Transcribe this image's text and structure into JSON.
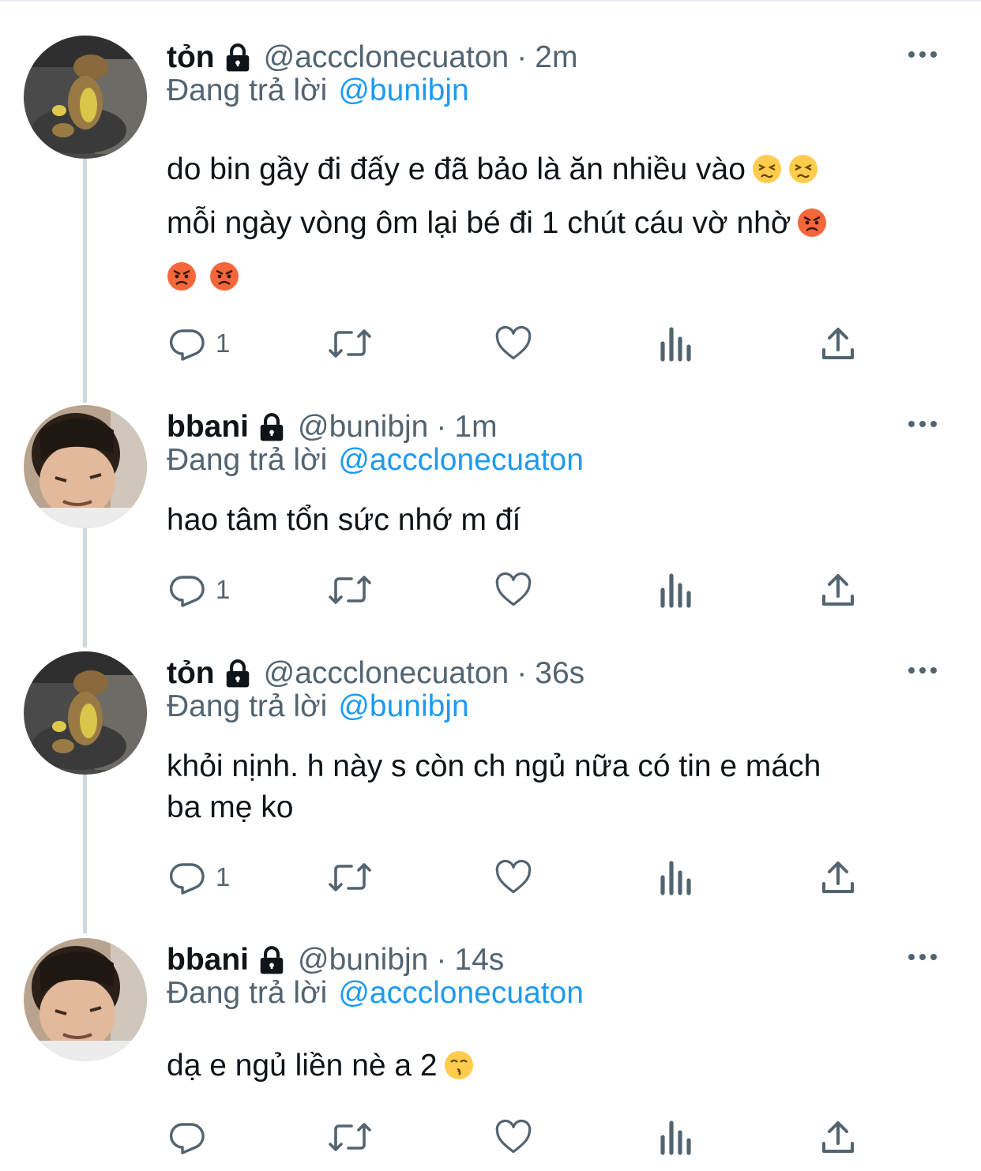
{
  "tweets": [
    {
      "name": "tỏn",
      "handle": "@accclonecuaton",
      "separator": "·",
      "time": "2m",
      "reply_label": "Đang trả lời",
      "reply_to": "@bunibjn",
      "text_lines": [
        "do bin gầy đi đấy e đã bảo là ăn nhiều vào",
        "mỗi ngày vòng ôm lại bé đi 1 chút cáu vờ nhờ"
      ],
      "reply_count": "1",
      "avatar": "dinosaur-plush-photo"
    },
    {
      "name": "bbani",
      "handle": "@bunibjn",
      "separator": "·",
      "time": "1m",
      "reply_label": "Đang trả lời",
      "reply_to": "@accclonecuaton",
      "text_lines": [
        "hao tâm tổn sức nhớ m đí"
      ],
      "reply_count": "1",
      "avatar": "person-face-photo"
    },
    {
      "name": "tỏn",
      "handle": "@accclonecuaton",
      "separator": "·",
      "time": "36s",
      "reply_label": "Đang trả lời",
      "reply_to": "@bunibjn",
      "text_lines": [
        "khỏi nịnh. h này s còn ch ngủ nữa có tin e mách",
        "ba mẹ ko"
      ],
      "reply_count": "1",
      "avatar": "dinosaur-plush-photo"
    },
    {
      "name": "bbani",
      "handle": "@bunibjn",
      "separator": "·",
      "time": "14s",
      "reply_label": "Đang trả lời",
      "reply_to": "@accclonecuaton",
      "text_lines": [
        "dạ e ngủ liền nè a 2"
      ],
      "reply_count": "",
      "avatar": "person-face-photo"
    }
  ],
  "icons": {
    "lock": "lock-icon",
    "more": "more-icon",
    "reply": "reply-icon",
    "retweet": "retweet-icon",
    "like": "heart-icon",
    "views": "analytics-icon",
    "share": "share-icon",
    "emoji_persevering": "persevering-face-emoji",
    "emoji_angry": "angry-face-emoji",
    "emoji_kissing": "kissing-face-emoji"
  },
  "colors": {
    "text": "#0f1419",
    "secondary": "#536471",
    "link": "#1d9bf0",
    "thread_line": "#cfd9de"
  }
}
